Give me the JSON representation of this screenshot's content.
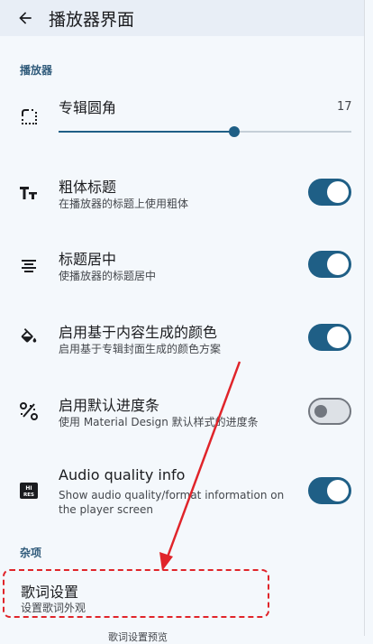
{
  "appbar": {
    "title": "播放器界面"
  },
  "sections": {
    "player": "播放器",
    "misc": "杂项"
  },
  "album_corner": {
    "title": "专辑圆角",
    "value": "17",
    "fraction": 0.6
  },
  "settings": [
    {
      "title": "粗体标题",
      "summary": "在播放器的标题上使用粗体",
      "enabled": true
    },
    {
      "title": "标题居中",
      "summary": "使播放器的标题居中",
      "enabled": true
    },
    {
      "title": "启用基于内容生成的颜色",
      "summary": "启用基于专辑封面生成的颜色方案",
      "enabled": true
    },
    {
      "title": "启用默认进度条",
      "summary": "使用 Material Design 默认样式的进度条",
      "enabled": false
    },
    {
      "title": "Audio quality info",
      "summary": "Show audio quality/format information on the player screen",
      "enabled": true
    }
  ],
  "lyrics": {
    "title": "歌词设置",
    "summary": "设置歌词外观"
  },
  "bottom_cutoff": "歌词设置预览",
  "colors": {
    "accent": "#1f5f86",
    "annotation": "#e0242a"
  }
}
